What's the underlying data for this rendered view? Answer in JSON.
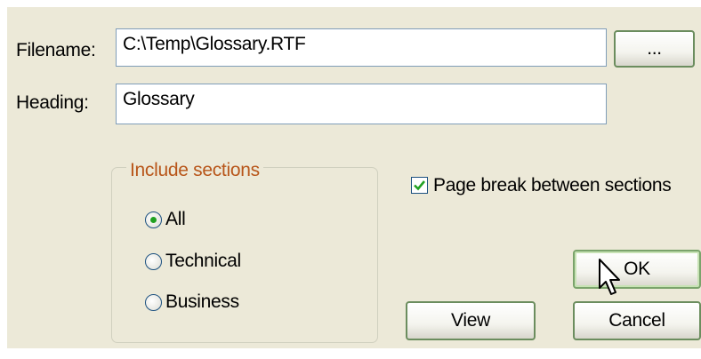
{
  "form": {
    "filename_label": "Filename:",
    "filename_value": "C:\\Temp\\Glossary.RTF",
    "browse_label": "...",
    "heading_label": "Heading:",
    "heading_value": "Glossary"
  },
  "sections": {
    "title": "Include sections",
    "options": [
      {
        "label": "All",
        "selected": true
      },
      {
        "label": "Technical",
        "selected": false
      },
      {
        "label": "Business",
        "selected": false
      }
    ]
  },
  "options": {
    "page_break_label": "Page break between sections",
    "page_break_checked": true
  },
  "buttons": {
    "ok": "OK",
    "view": "View",
    "cancel": "Cancel"
  },
  "colors": {
    "dialog_bg": "#ece9d8",
    "group_title": "#b8561a",
    "button_border": "#6b8d5e",
    "check_green": "#21a121"
  }
}
